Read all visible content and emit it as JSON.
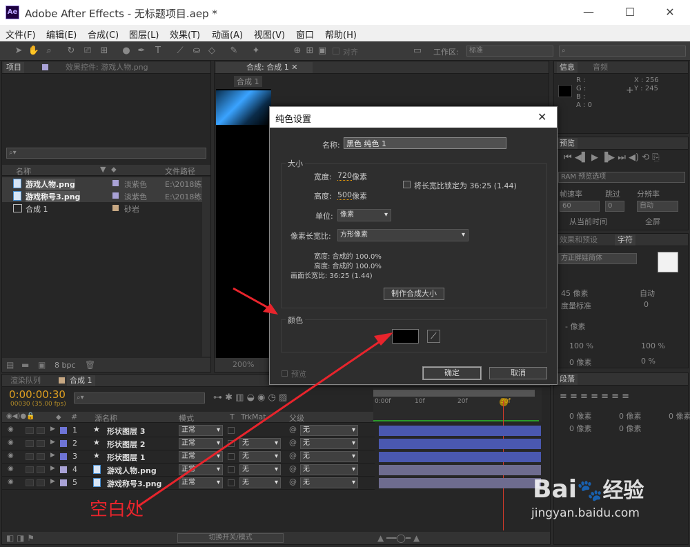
{
  "window": {
    "title": "Adobe After Effects - 无标题项目.aep *",
    "logo": "Ae",
    "min": "—",
    "max": "☐",
    "close": "✕"
  },
  "menu": [
    "文件(F)",
    "编辑(E)",
    "合成(C)",
    "图层(L)",
    "效果(T)",
    "动画(A)",
    "视图(V)",
    "窗口",
    "帮助(H)"
  ],
  "toolbar": {
    "align_label": "对齐",
    "workspace_label": "工作区:",
    "workspace_value": "标准"
  },
  "project": {
    "tab_project": "项目",
    "tab_effects": "效果控件: 游戏人物.png",
    "columns": {
      "name": "名称",
      "path": "文件路径"
    },
    "items": [
      {
        "name": "游戏人物.png",
        "label": "淡紫色",
        "path": "E:\\2018练",
        "color": "#a9a2d6"
      },
      {
        "name": "游戏称号3.png",
        "label": "淡紫色",
        "path": "E:\\2018练",
        "color": "#a9a2d6"
      },
      {
        "name": "合成 1",
        "label": "砂岩",
        "path": "",
        "color": "#c7a883"
      }
    ],
    "bpc": "8 bpc"
  },
  "comp": {
    "tab": "合成: 合成 1",
    "crumb": "合成 1",
    "zoom": "200%"
  },
  "info": {
    "tab_info": "信息",
    "tab_audio": "音频",
    "r": "R :",
    "g": "G :",
    "b": "B :",
    "a": "A : 0",
    "x": "X : 256",
    "y": "Y : 245"
  },
  "preview": {
    "tab": "预览",
    "ram": "RAM 预览选项",
    "fps_label": "帧速率",
    "skip_label": "跳过",
    "res_label": "分辨率",
    "fps": "60",
    "skip": "0",
    "res": "自动",
    "from_current": "从当前时间",
    "fullscreen": "全屏"
  },
  "effects_tab": "效果和预设",
  "char": {
    "tab": "字符",
    "font": "方正胖娃简体",
    "size": "45 像素",
    "leading": "自动",
    "kern": "度量标准",
    "track": "0",
    "stroke": "- 像素",
    "vscale": "100 %",
    "hscale": "100 %",
    "baseline": "0 像素",
    "tsume": "0 %"
  },
  "para": {
    "tab": "段落",
    "v1": "0 像素",
    "v2": "0 像素",
    "v3": "0 像素",
    "v4": "0 像素",
    "v5": "0 像素"
  },
  "timeline": {
    "tab_render": "渲染队列",
    "tab_comp": "合成 1",
    "timecode": "0:00:00:30",
    "fps": "00030 (35.00 fps)",
    "columns": {
      "num": "#",
      "name": "源名称",
      "mode": "模式",
      "t": "T",
      "trkmat": "TrkMat",
      "parent": "父级"
    },
    "ruler": [
      "0:00f",
      "10f",
      "20f",
      "30f"
    ],
    "layers": [
      {
        "num": "1",
        "name": "形状图层 3",
        "mode": "正常",
        "trk": "",
        "parent": "无",
        "color": "#6e74d6",
        "bar": "#4a58b0",
        "kind": "star"
      },
      {
        "num": "2",
        "name": "形状图层 2",
        "mode": "正常",
        "trk": "无",
        "parent": "无",
        "color": "#6e74d6",
        "bar": "#4a58b0",
        "kind": "star"
      },
      {
        "num": "3",
        "name": "形状图层 1",
        "mode": "正常",
        "trk": "无",
        "parent": "无",
        "color": "#6e74d6",
        "bar": "#4a58b0",
        "kind": "star"
      },
      {
        "num": "4",
        "name": "游戏人物.png",
        "mode": "正常",
        "trk": "无",
        "parent": "无",
        "color": "#a9a2d6",
        "bar": "#6e6c8f",
        "kind": "file"
      },
      {
        "num": "5",
        "name": "游戏称号3.png",
        "mode": "正常",
        "trk": "无",
        "parent": "无",
        "color": "#a9a2d6",
        "bar": "#6e6c8f",
        "kind": "file"
      }
    ],
    "switch_mode": "切换开关/模式"
  },
  "dialog": {
    "title": "纯色设置",
    "name_label": "名称:",
    "name_value": "黑色 纯色 1",
    "size_group": "大小",
    "width_label": "宽度:",
    "width_value": "720",
    "height_label": "高度:",
    "height_value": "500",
    "px": "像素",
    "lock_label": "将长宽比锁定为 36:25 (1.44)",
    "unit_label": "单位:",
    "unit_value": "像素",
    "par_label": "像素长宽比:",
    "par_value": "方形像素",
    "info_w": "宽度: 合成的 100.0%",
    "info_h": "高度: 合成的 100.0%",
    "info_frame": "画面长宽比: 36:25 (1.44)",
    "make_comp_size": "制作合成大小",
    "color_group": "颜色",
    "color_value": "#000000",
    "preview": "预览",
    "ok": "确定",
    "cancel": "取消"
  },
  "annotation": {
    "text": "空白处",
    "color": "#e8242c"
  },
  "watermark": {
    "brand": "Bai",
    "brand2": "经验",
    "url": "jingyan.baidu.com"
  }
}
